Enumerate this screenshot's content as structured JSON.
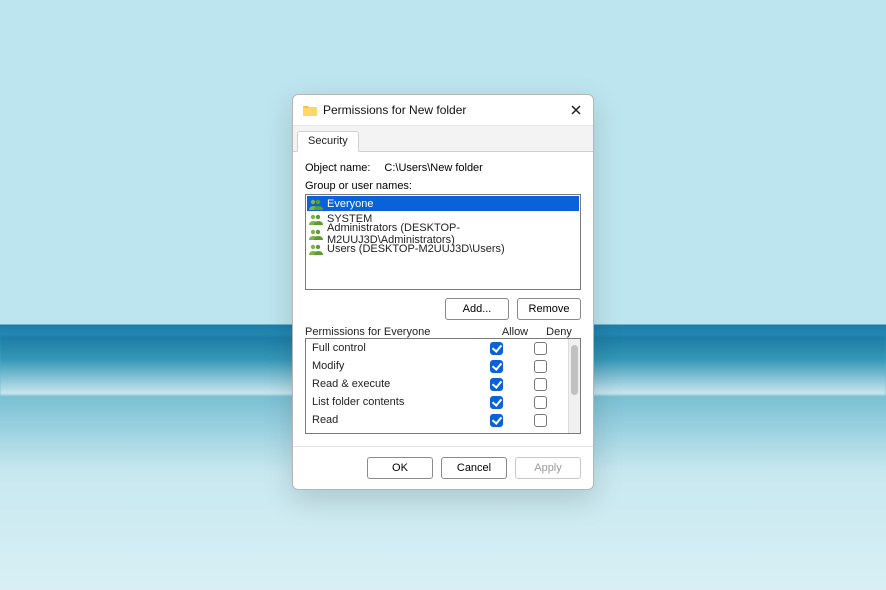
{
  "dialog": {
    "title": "Permissions for New folder",
    "tab": "Security",
    "object_label": "Object name:",
    "object_value": "C:\\Users\\New folder",
    "groups_label": "Group or user names:",
    "groups": [
      {
        "name": "Everyone",
        "selected": true
      },
      {
        "name": "SYSTEM",
        "selected": false
      },
      {
        "name": "Administrators (DESKTOP-M2UUJ3D\\Administrators)",
        "selected": false
      },
      {
        "name": "Users (DESKTOP-M2UUJ3D\\Users)",
        "selected": false
      }
    ],
    "buttons": {
      "add": "Add...",
      "remove": "Remove",
      "ok": "OK",
      "cancel": "Cancel",
      "apply": "Apply"
    },
    "perm_header_for": "Permissions for Everyone",
    "perm_col_allow": "Allow",
    "perm_col_deny": "Deny",
    "permissions": [
      {
        "name": "Full control",
        "allow": true,
        "deny": false
      },
      {
        "name": "Modify",
        "allow": true,
        "deny": false
      },
      {
        "name": "Read & execute",
        "allow": true,
        "deny": false
      },
      {
        "name": "List folder contents",
        "allow": true,
        "deny": false
      },
      {
        "name": "Read",
        "allow": true,
        "deny": false
      }
    ]
  }
}
